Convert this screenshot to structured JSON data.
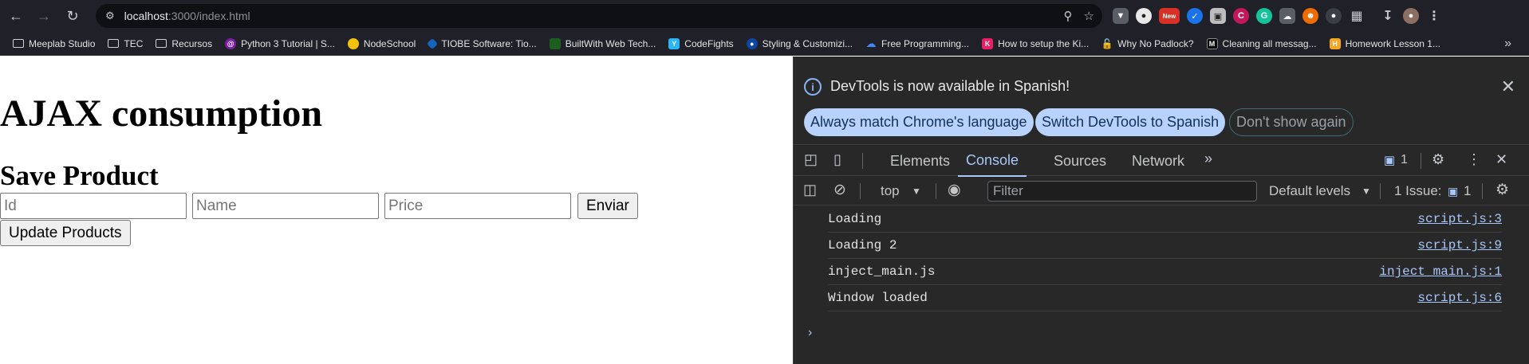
{
  "browser": {
    "url_host": "localhost",
    "url_rest": ":3000/index.html",
    "new_badge": "New"
  },
  "bookmarks": [
    {
      "label": "Meeplab Studio",
      "icon": "folder-icon"
    },
    {
      "label": "TEC",
      "icon": "folder-icon"
    },
    {
      "label": "Recursos",
      "icon": "folder-icon"
    },
    {
      "label": "Python 3 Tutorial | S...",
      "icon": "python-icon"
    },
    {
      "label": "NodeSchool",
      "icon": "hexagon-icon"
    },
    {
      "label": "TIOBE Software: Tio...",
      "icon": "tiobe-icon"
    },
    {
      "label": "BuiltWith Web Tech...",
      "icon": "builtwith-icon"
    },
    {
      "label": "CodeFights",
      "icon": "codefights-icon"
    },
    {
      "label": "Styling & Customizi...",
      "icon": "styling-icon"
    },
    {
      "label": "Free Programming...",
      "icon": "cloud-icon"
    },
    {
      "label": "How to setup the Ki...",
      "icon": "kibana-icon"
    },
    {
      "label": "Why No Padlock?",
      "icon": "padlock-icon"
    },
    {
      "label": "Cleaning all messag...",
      "icon": "medium-icon"
    },
    {
      "label": "Homework Lesson 1...",
      "icon": "homework-icon"
    }
  ],
  "page": {
    "title": "AJAX consumption",
    "subtitle": "Save Product",
    "id_placeholder": "Id",
    "name_placeholder": "Name",
    "price_placeholder": "Price",
    "submit_label": "Enviar",
    "update_label": "Update Products"
  },
  "devtools": {
    "info_text": "DevTools is now available in Spanish!",
    "info_buttons": {
      "match": "Always match Chrome's language",
      "switch": "Switch DevTools to Spanish",
      "dismiss": "Don't show again"
    },
    "tabs": [
      "Elements",
      "Console",
      "Sources",
      "Network"
    ],
    "active_tab": "Console",
    "message_count": "1",
    "context": "top",
    "filter_placeholder": "Filter",
    "levels": "Default levels",
    "issues_label": "1 Issue:",
    "issues_count": "1",
    "logs": [
      {
        "message": "Loading",
        "source": "script.js:3"
      },
      {
        "message": "Loading 2",
        "source": "script.js:9"
      },
      {
        "message": "inject_main.js",
        "source": "inject_main.js:1"
      },
      {
        "message": "Window loaded",
        "source": "script.js:6"
      }
    ]
  }
}
